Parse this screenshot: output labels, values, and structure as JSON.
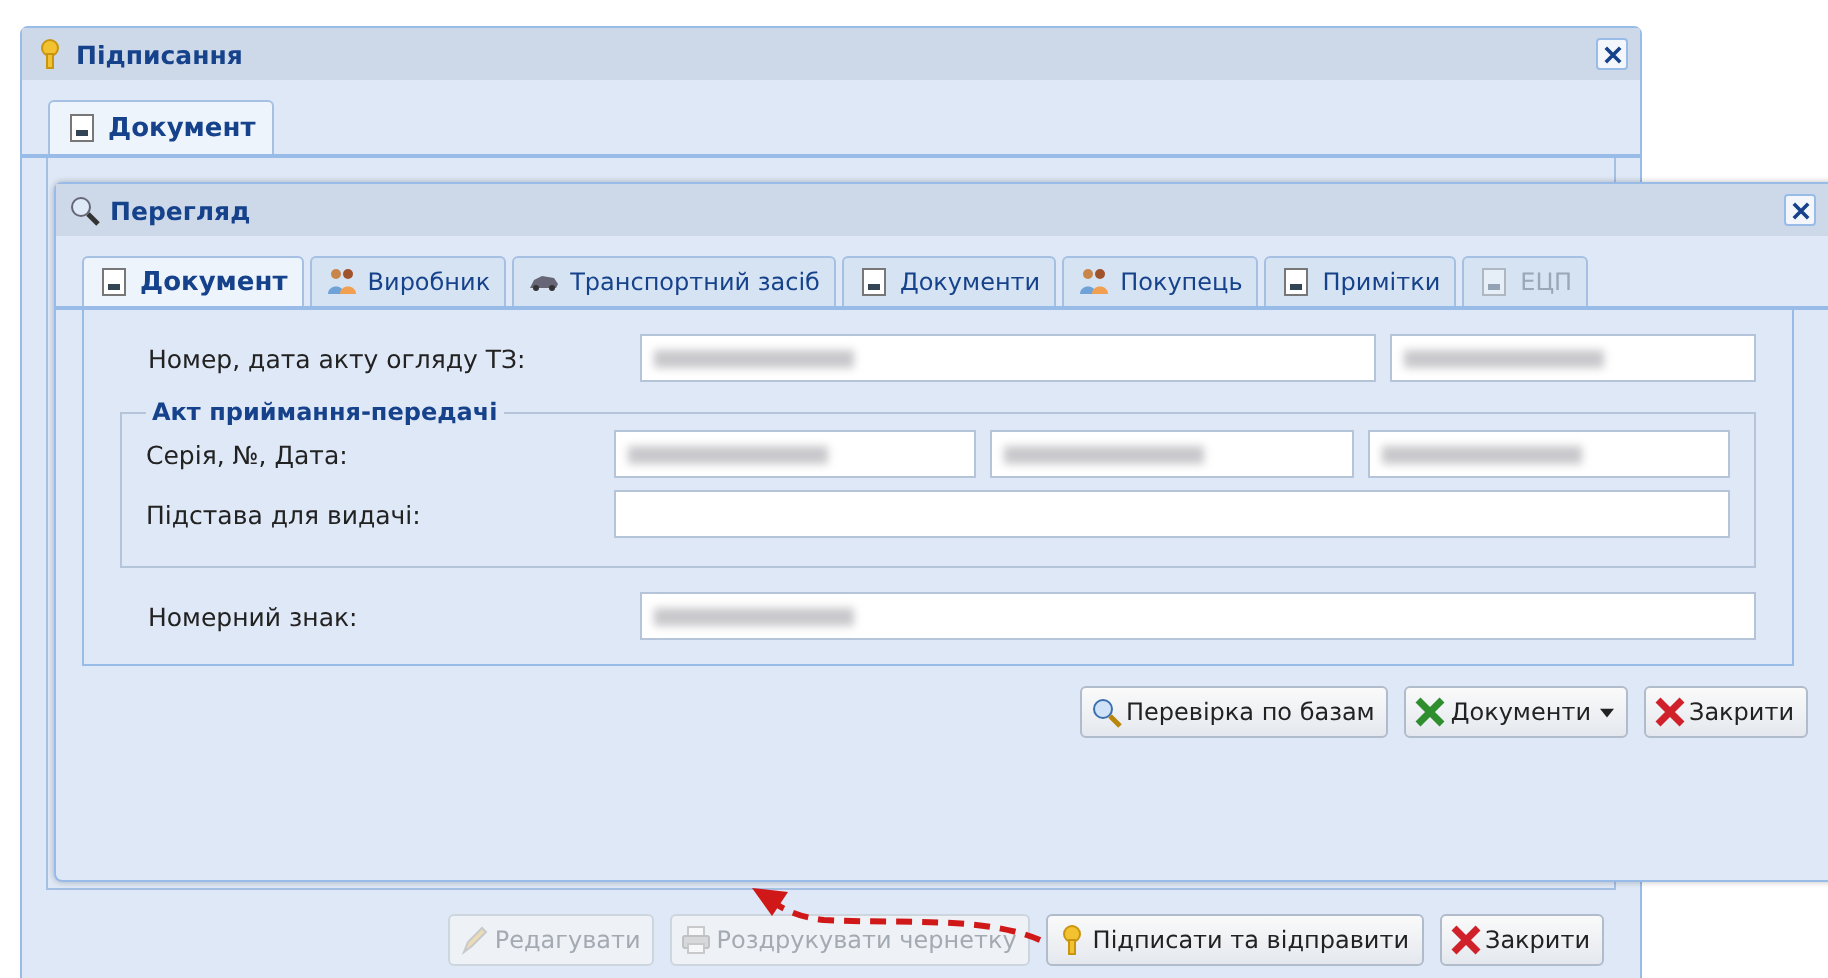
{
  "window": {
    "title": "Підписання"
  },
  "tabs": [
    {
      "label": "Документ",
      "selected": true,
      "kind": "doc"
    }
  ],
  "viewer": {
    "title": "Перегляд",
    "tabs": [
      {
        "label": "Документ",
        "selected": true,
        "disabled": false,
        "kind": "doc"
      },
      {
        "label": "Виробник",
        "selected": false,
        "disabled": false,
        "kind": "people"
      },
      {
        "label": "Транспортний засіб",
        "selected": false,
        "disabled": false,
        "kind": "car"
      },
      {
        "label": "Документи",
        "selected": false,
        "disabled": false,
        "kind": "doc"
      },
      {
        "label": "Покупець",
        "selected": false,
        "disabled": false,
        "kind": "people"
      },
      {
        "label": "Примітки",
        "selected": false,
        "disabled": false,
        "kind": "doc"
      },
      {
        "label": "ЕЦП",
        "selected": false,
        "disabled": true,
        "kind": "doc"
      }
    ],
    "inspection": {
      "label": "Номер, дата акту огляду ТЗ:",
      "fields": [
        {
          "obscured": true
        },
        {
          "obscured": true
        }
      ]
    },
    "group": {
      "legend": "Акт приймання-передачі",
      "rows": [
        {
          "label": "Серія, №, Дата:",
          "fields": [
            {
              "obscured": true
            },
            {
              "obscured": true
            },
            {
              "obscured": true
            }
          ]
        },
        {
          "label": "Підстава для видачі:",
          "fields": [
            {
              "obscured": false
            }
          ]
        }
      ]
    },
    "plate": {
      "label": "Номерний знак:",
      "fields": [
        {
          "obscured": true
        }
      ]
    },
    "buttons": [
      {
        "label": "Перевірка по базам",
        "kind": "search",
        "menu": false
      },
      {
        "label": "Документи",
        "kind": "excel",
        "menu": true
      },
      {
        "label": "Закрити",
        "kind": "close",
        "menu": false
      }
    ]
  },
  "buttons": [
    {
      "label": "Редагувати",
      "kind": "pencil",
      "disabled": true
    },
    {
      "label": "Роздрукувати чернетку",
      "kind": "printer",
      "disabled": true
    },
    {
      "label": "Підписати та відправити",
      "kind": "key",
      "disabled": false
    },
    {
      "label": "Закрити",
      "kind": "close",
      "disabled": false
    }
  ]
}
